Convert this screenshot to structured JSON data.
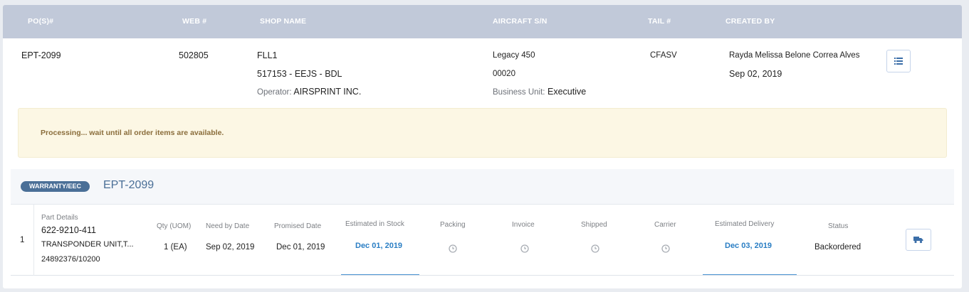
{
  "header": {
    "po": "PO(S)#",
    "web": "WEB #",
    "shop": "SHOP NAME",
    "aircraft": "AIRCRAFT S/N",
    "tail": "TAIL #",
    "created": "CREATED BY"
  },
  "order_summary": {
    "po": "EPT-2099",
    "web": "502805",
    "shop_name": "FLL1",
    "shop_code": "517153 - EEJS - BDL",
    "operator_label": "Operator:",
    "operator_value": "AIRSPRINT INC.",
    "aircraft_model": "Legacy 450",
    "aircraft_sn": "00020",
    "business_unit_label": "Business Unit:",
    "business_unit_value": "Executive",
    "tail": "CFASV",
    "created_by": "Rayda Melissa Belone Correa Alves",
    "created_date": "Sep 02, 2019"
  },
  "alert": {
    "message": "Processing... wait until all order items are available."
  },
  "order": {
    "badge": "WARRANTY/EEC",
    "id": "EPT-2099",
    "columns": {
      "part_details": "Part Details",
      "qty": "Qty (UOM)",
      "need_by": "Need by Date",
      "promised": "Promised Date",
      "est_stock": "Estimated in Stock",
      "packing": "Packing",
      "invoice": "Invoice",
      "shipped": "Shipped",
      "carrier": "Carrier",
      "est_delivery": "Estimated Delivery",
      "status": "Status"
    },
    "items": [
      {
        "index": "1",
        "part_number": "622-9210-411",
        "description": "TRANSPONDER UNIT,T...",
        "ref": "24892376/10200",
        "qty": "1 (EA)",
        "need_by": "Sep 02, 2019",
        "promised": "Dec 01, 2019",
        "est_stock": "Dec 01, 2019",
        "est_delivery": "Dec 03, 2019",
        "status": "Backordered"
      }
    ]
  },
  "icons": {
    "list": "list-icon",
    "clock": "clock-icon",
    "truck": "truck-icon"
  },
  "colors": {
    "header_bg": "#c1c9d9",
    "badge_bg": "#4a6f97",
    "link_blue": "#2a7ec4",
    "alert_bg": "#fcf7e4",
    "alert_text": "#8a6d3b"
  }
}
